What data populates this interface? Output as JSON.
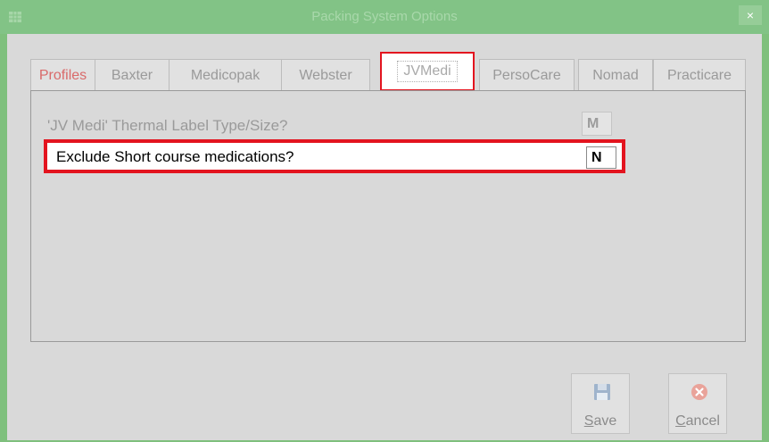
{
  "window": {
    "title": "Packing System Options",
    "close_label": "×"
  },
  "tabs": [
    {
      "label": "Profiles"
    },
    {
      "label": "Baxter"
    },
    {
      "label": "Medicopak"
    },
    {
      "label": "Webster"
    },
    {
      "label": "JVMedi"
    },
    {
      "label": "PersoCare"
    },
    {
      "label": "Nomad"
    },
    {
      "label": "Practicare"
    }
  ],
  "selected_tab": "JVMedi",
  "options": [
    {
      "label": "'JV Medi' Thermal Label Type/Size?",
      "value": "M"
    },
    {
      "label": "Exclude Short course medications?",
      "value": "N"
    }
  ],
  "buttons": {
    "save": {
      "first": "S",
      "rest": "ave"
    },
    "cancel": {
      "first": "C",
      "rest": "ancel"
    }
  },
  "colors": {
    "titlebar": "#82c386",
    "highlight": "#e3141f",
    "client": "#d9d9d9"
  },
  "icons": {
    "save": "floppy-disk-icon",
    "cancel": "cancel-circle-icon"
  }
}
